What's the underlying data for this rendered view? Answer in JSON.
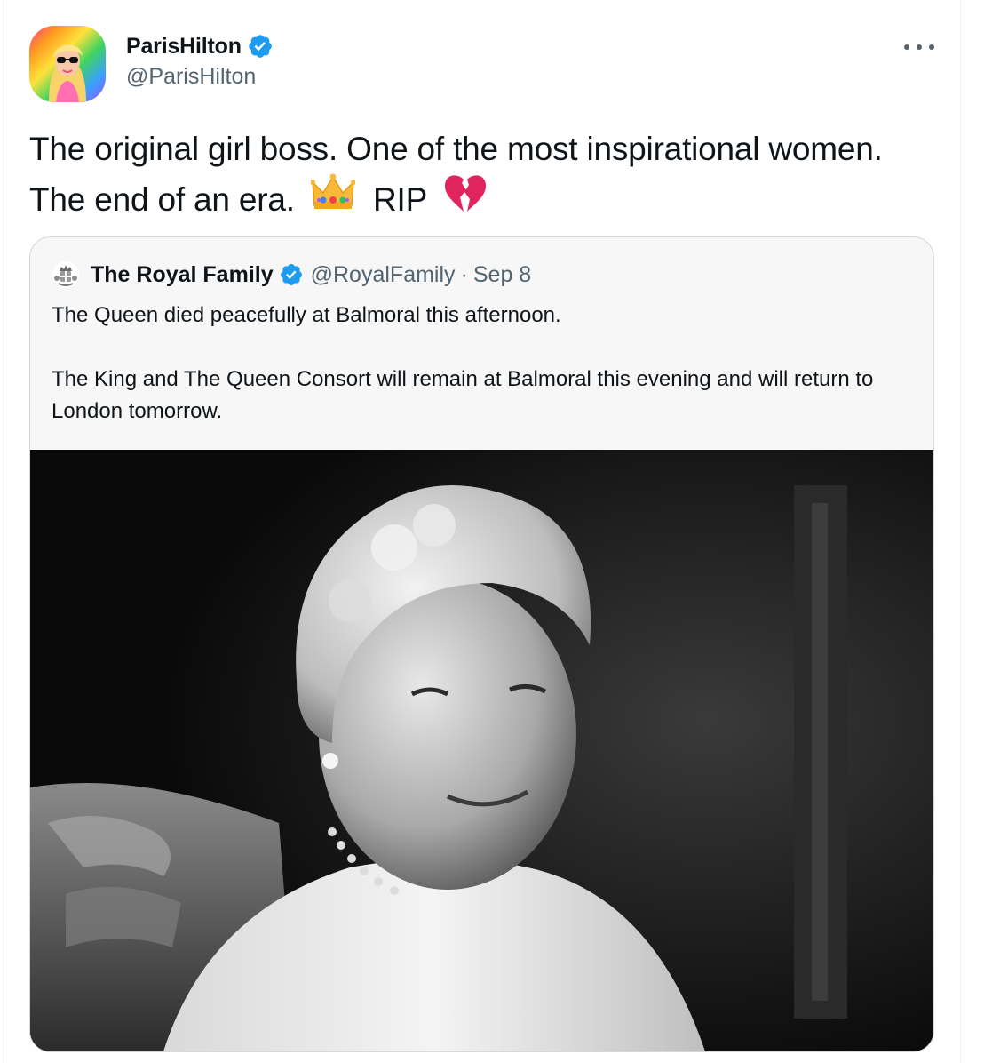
{
  "author": {
    "display_name": "ParisHilton",
    "handle": "@ParisHilton",
    "verified": true,
    "avatar_icon": "profile-avatar"
  },
  "more_icon": "more-horizontal-icon",
  "tweet": {
    "text_part1": "The original girl boss. One of the most inspirational women. The end of an era.",
    "emoji_1": "crown-emoji",
    "text_part2": "RIP",
    "emoji_2": "broken-heart-emoji"
  },
  "quoted_tweet": {
    "display_name": "The Royal Family",
    "handle": "@RoyalFamily",
    "separator": "·",
    "date": "Sep 8",
    "verified": true,
    "paragraph_1": "The Queen died peacefully at Balmoral this afternoon.",
    "paragraph_2": "The King and The Queen Consort will remain at Balmoral this evening and will return to London tomorrow.",
    "media_icon": "black-and-white-portrait-photo"
  },
  "colors": {
    "verified_blue": "#1d9bf0",
    "text_primary": "#0f1419",
    "text_secondary": "#536471",
    "border": "#cfd9de"
  }
}
